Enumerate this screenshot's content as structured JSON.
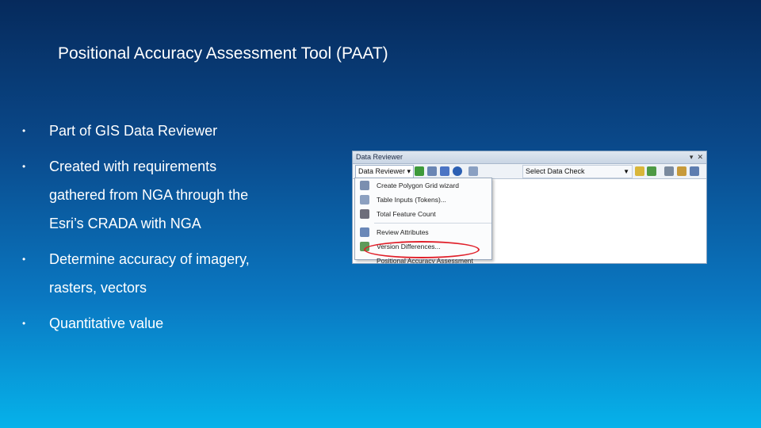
{
  "slide": {
    "title": "Positional Accuracy Assessment Tool (PAAT)",
    "bullets": [
      {
        "lines": [
          "Part of GIS Data Reviewer"
        ]
      },
      {
        "lines": [
          "Created with requirements",
          "gathered from NGA through the",
          "Esri’s CRADA with NGA"
        ]
      },
      {
        "lines": [
          "Determine accuracy of imagery,",
          "rasters, vectors"
        ]
      },
      {
        "lines": [
          "Quantitative value"
        ]
      }
    ],
    "bullet_glyph": "•"
  },
  "screenshot": {
    "window_title": "Data Reviewer",
    "toolbar_dropdown": "Data Reviewer ▾",
    "check_dropdown": "Select Data Check",
    "menu_items": [
      "Create Polygon Grid wizard",
      "Table Inputs (Tokens)...",
      "Total Feature Count",
      "Review Attributes",
      "Version Differences...",
      "Positional Accuracy Assessment"
    ],
    "highlight_color": "#e0202a"
  }
}
